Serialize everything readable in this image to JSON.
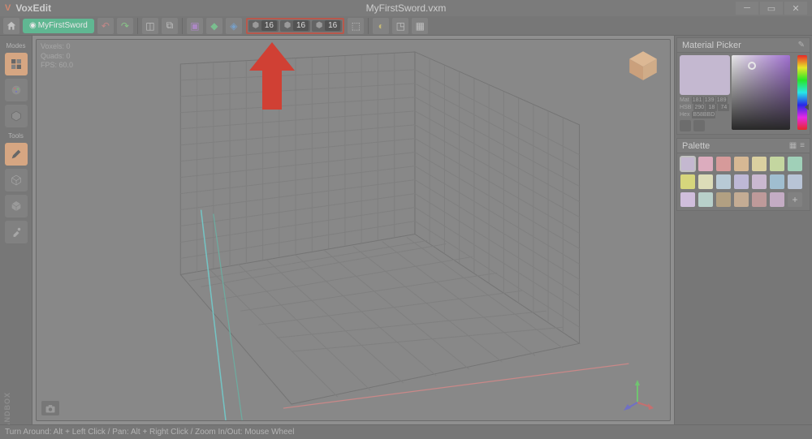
{
  "titlebar": {
    "logo_char": "V",
    "app_name": "VoxEdit",
    "file_name": "MyFirstSword.vxm"
  },
  "toolbar": {
    "project_label": "MyFirstSword",
    "dims": {
      "x": "16",
      "y": "16",
      "z": "16"
    }
  },
  "left": {
    "modes_label": "Modes",
    "tools_label": "Tools"
  },
  "viewport": {
    "voxels_label": "Voxels: 0",
    "quads_label": "Quads: 0",
    "fps_label": "FPS: 60.0"
  },
  "right": {
    "material_title": "Material Picker",
    "palette_title": "Palette",
    "mat_values": {
      "mat_label": "Mat",
      "mat_r": "181",
      "mat_g": "139",
      "mat_b": "189",
      "hsb_label": "HSB",
      "hsb_h": "290",
      "hsb_s": "18",
      "hsb_b": "74",
      "hex_label": "Hex",
      "hex_val": "B58BBD"
    },
    "palette_colors": [
      "#d0c0e0",
      "#f0b0c8",
      "#e89898",
      "#e8c090",
      "#eee0a0",
      "#d0e8a0",
      "#a0e0c0",
      "#e8e870",
      "#f0f0c0",
      "#c0d8e8",
      "#c8c0e8",
      "#d8c0e0",
      "#a0c8e0",
      "#c0d0e8",
      "#e0c8f0",
      "#c0e0d8",
      "#b8a078",
      "#d0b090",
      "#c89898",
      "#d0b0d0"
    ]
  },
  "status": {
    "hint": "Turn Around: Alt + Left Click / Pan: Alt + Right Click / Zoom In/Out: Mouse Wheel"
  },
  "sandbox_text": "SANDBOX"
}
